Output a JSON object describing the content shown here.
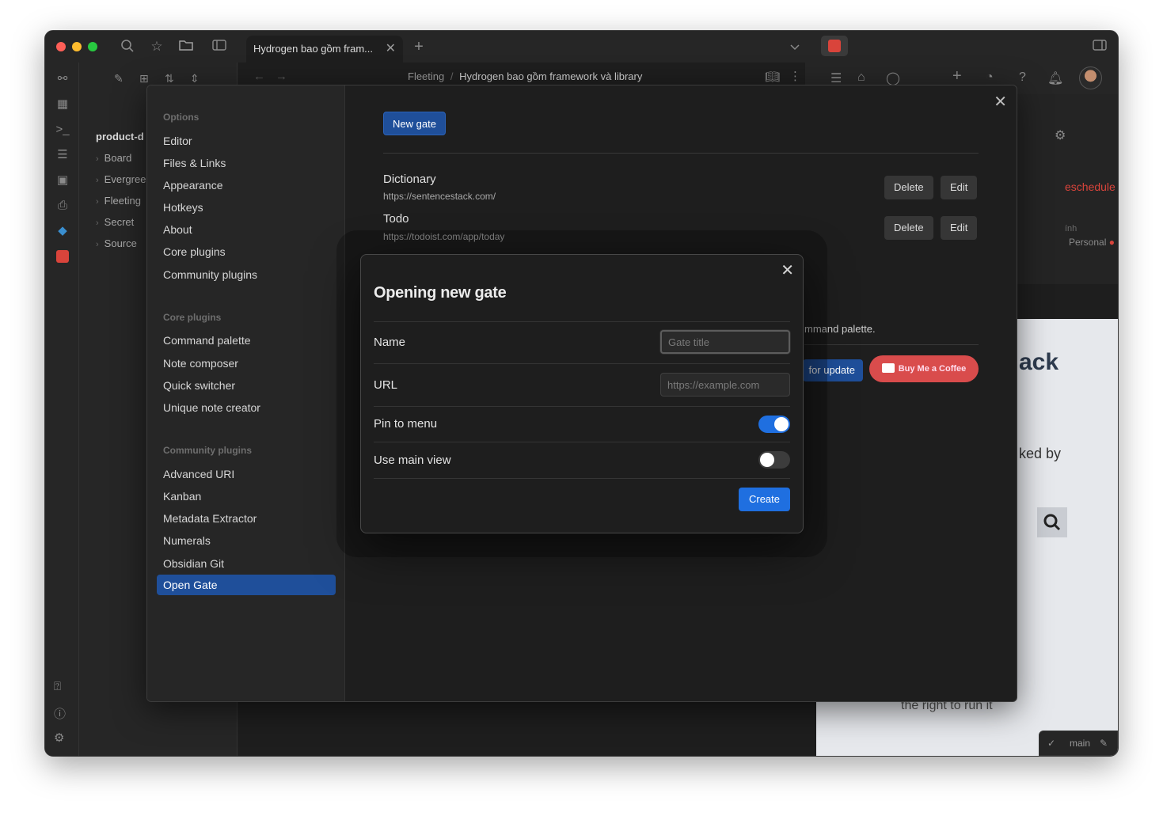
{
  "window": {
    "tab_title": "Hydrogen bao gồm fram...",
    "tab_close": "✕",
    "new_tab": "+"
  },
  "explorer": {
    "vault": "product-d",
    "folders": [
      "Board",
      "Evergree",
      "Fleeting",
      "Secret",
      "Source"
    ]
  },
  "editor": {
    "breadcrumb_parent": "Fleeting",
    "breadcrumb_sep": "/",
    "breadcrumb_current": "Hydrogen bao gồm framework và library"
  },
  "right_panel": {
    "reschedule": "eschedule",
    "tag_line1": "ính",
    "tag_line2": "Personal"
  },
  "webview": {
    "heading": "ack",
    "text1": "ked by",
    "text2": "the right to run it"
  },
  "status": {
    "branch": "main"
  },
  "settings": {
    "close": "✕",
    "nav": {
      "options_head": "Options",
      "options": [
        "Editor",
        "Files & Links",
        "Appearance",
        "Hotkeys",
        "About",
        "Core plugins",
        "Community plugins"
      ],
      "core_head": "Core plugins",
      "core": [
        "Command palette",
        "Note composer",
        "Quick switcher",
        "Unique note creator"
      ],
      "community_head": "Community plugins",
      "community": [
        "Advanced URI",
        "Kanban",
        "Metadata Extractor",
        "Numerals",
        "Obsidian Git"
      ],
      "active": "Open Gate"
    },
    "new_gate_label": "New gate",
    "gates": [
      {
        "name": "Dictionary",
        "url": "https://sentencestack.com/"
      },
      {
        "name": "Todo",
        "url": "https://todoist.com/app/today"
      }
    ],
    "delete_label": "Delete",
    "edit_label": "Edit",
    "palette_text": "mmand palette.",
    "update_label": "for update",
    "coffee_label": "Buy Me a Coffee"
  },
  "modal": {
    "title": "Opening new gate",
    "close": "✕",
    "name_label": "Name",
    "name_placeholder": "Gate title",
    "url_label": "URL",
    "url_placeholder": "https://example.com",
    "pin_label": "Pin to menu",
    "pin_on": true,
    "main_view_label": "Use main view",
    "main_view_on": false,
    "create_label": "Create"
  },
  "colors": {
    "accent": "#1f6fe0",
    "active_nav": "#1f4f9a",
    "coffee": "#d94c4c",
    "traffic_red": "#ff5f57",
    "traffic_yellow": "#febc2e",
    "traffic_green": "#28c840"
  }
}
